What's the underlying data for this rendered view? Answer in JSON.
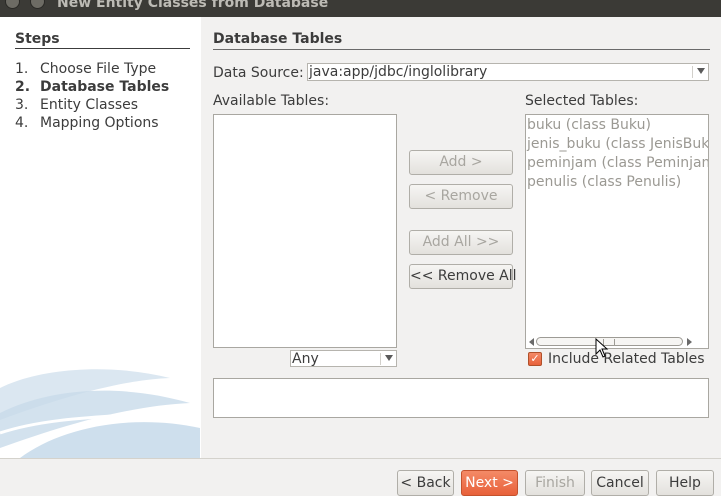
{
  "window": {
    "title": "New Entity Classes from Database"
  },
  "steps": {
    "heading": "Steps",
    "items": [
      {
        "num": "1.",
        "label": "Choose File Type"
      },
      {
        "num": "2.",
        "label": "Database Tables"
      },
      {
        "num": "3.",
        "label": "Entity Classes"
      },
      {
        "num": "4.",
        "label": "Mapping Options"
      }
    ],
    "active_index": 1
  },
  "panel": {
    "title": "Database Tables",
    "data_source_label": "Data Source:",
    "data_source_value": "java:app/jdbc/inglolibrary",
    "available_label": "Available Tables:",
    "selected_label": "Selected Tables:",
    "filter_value": "Any",
    "selected_tables": [
      "buku (class Buku)",
      "jenis_buku (class JenisBuku)",
      "peminjam (class Peminjam)",
      "penulis (class Penulis)"
    ],
    "include_related_label": "Include Related Tables",
    "include_related_checked": true
  },
  "buttons": {
    "add": "Add >",
    "remove": "< Remove",
    "add_all": "Add All >>",
    "remove_all": "<< Remove All",
    "back": "< Back",
    "next": "Next >",
    "finish": "Finish",
    "cancel": "Cancel",
    "help": "Help"
  },
  "colors": {
    "accent": "#e8613a",
    "disabled_text": "#a8a6a0"
  }
}
